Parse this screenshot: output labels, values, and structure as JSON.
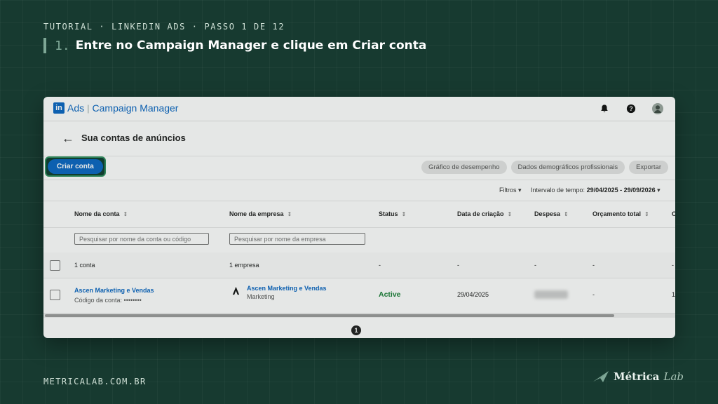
{
  "slide": {
    "eyebrow": "TUTORIAL · LINKEDIN ADS · PASSO 1 DE 12",
    "step_number": "1.",
    "step_text": "Entre no Campaign Manager e clique em Criar conta",
    "footer_url": "METRICALAB.COM.BR",
    "brand_main": "Métrica",
    "brand_lab": "Lab"
  },
  "app": {
    "logo_in": "in",
    "logo_ads": "Ads",
    "logo_sep": "|",
    "logo_title": "Campaign Manager",
    "icons": [
      "bell-icon",
      "help-icon",
      "avatar"
    ]
  },
  "page": {
    "title": "Sua contas de anúncios",
    "create_button": "Criar conta",
    "actions": [
      "Gráfico de desempenho",
      "Dados demográficos profissionais",
      "Exportar"
    ],
    "filters_label": "Filtros",
    "interval_label": "Intervalo de tempo:",
    "interval_value": "29/04/2025 - 29/09/2026"
  },
  "table": {
    "columns": [
      "Nome da conta",
      "Nome da empresa",
      "Status",
      "Data de criação",
      "Despesa",
      "Orçamento total",
      "C"
    ],
    "search_account_placeholder": "Pesquisar por nome da conta ou código",
    "search_company_placeholder": "Pesquisar por nome da empresa",
    "summary": {
      "accounts": "1 conta",
      "companies": "1 empresa",
      "status": "-",
      "created": "-",
      "spend": "-",
      "budget": "-",
      "extra": "-"
    },
    "row": {
      "account_name": "Ascen Marketing e Vendas",
      "account_code": "Código da conta: ••••••••",
      "company_name": "Ascen Marketing e Vendas",
      "company_sub": "Marketing",
      "status": "Active",
      "created": "29/04/2025",
      "budget": "-",
      "extra": "1"
    },
    "pagination_current": "1"
  },
  "colors": {
    "background": "#173a30",
    "linkedin_blue": "#0a66c2",
    "active_green": "#1a7f37",
    "highlight": "#2f8f5f"
  }
}
